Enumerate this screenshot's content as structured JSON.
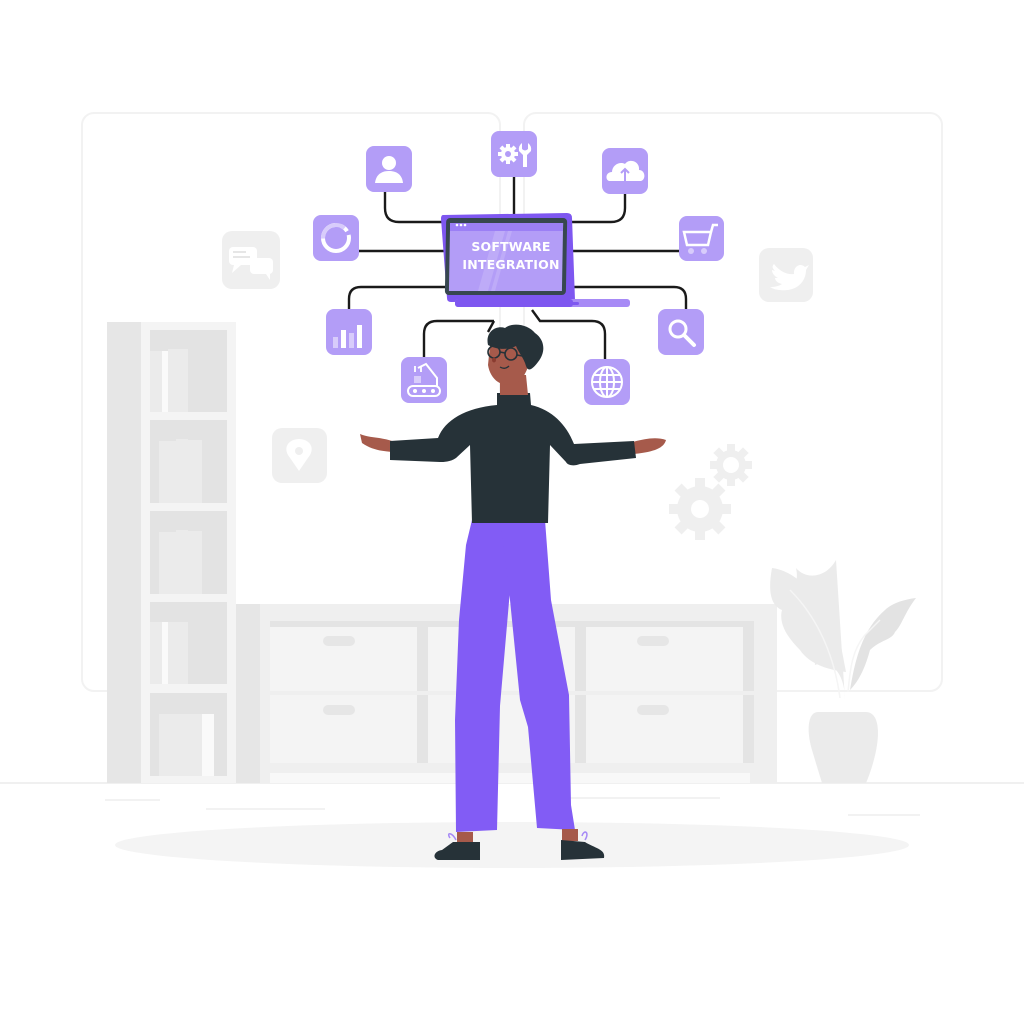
{
  "illustration": {
    "title": "Software Integration",
    "laptop": {
      "screen_line_1": "SOFTWARE",
      "screen_line_2": "INTEGRATION"
    },
    "connected_icons": [
      {
        "name": "user-profile"
      },
      {
        "name": "settings-gear-wrench"
      },
      {
        "name": "cloud-upload"
      },
      {
        "name": "loading-ring"
      },
      {
        "name": "shopping-cart"
      },
      {
        "name": "bar-chart"
      },
      {
        "name": "search-magnifier"
      },
      {
        "name": "robot-arm-conveyor"
      },
      {
        "name": "globe"
      }
    ],
    "background_icons": [
      {
        "name": "chat-bubbles"
      },
      {
        "name": "twitter-bird"
      },
      {
        "name": "location-pin"
      },
      {
        "name": "gears"
      }
    ],
    "colors": {
      "accent": "#B39DF7",
      "accent_dark": "#7E57F0",
      "pants": "#825CF5",
      "sweater": "#263238",
      "skin": "#A65A4B",
      "background_gray": "#EFEFEF"
    }
  }
}
